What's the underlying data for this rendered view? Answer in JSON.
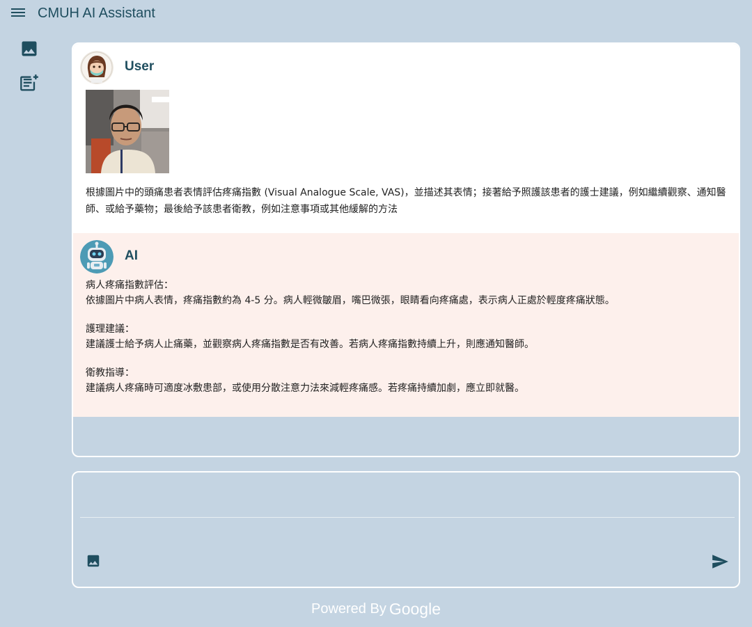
{
  "app": {
    "title": "CMUH AI Assistant"
  },
  "sidebar": {
    "icons": [
      {
        "name": "image-icon"
      },
      {
        "name": "note-add-icon"
      }
    ]
  },
  "chat": {
    "messages": [
      {
        "sender": "User",
        "avatar": "nurse-avatar",
        "image": "patient-photo",
        "text": "根據圖片中的頭痛患者表情評估疼痛指數 (Visual Analogue Scale, VAS)，並描述其表情；接著給予照護該患者的護士建議，例如繼續觀察、通知醫師、或給予藥物；最後給予該患者衛教，例如注意事項或其他緩解的方法"
      },
      {
        "sender": "AI",
        "avatar": "robot-avatar",
        "sections": [
          {
            "heading": "病人疼痛指數評估：",
            "body": "依據圖片中病人表情，疼痛指數約為 4-5 分。病人輕微皺眉，嘴巴微張，眼睛看向疼痛處，表示病人正處於輕度疼痛狀態。"
          },
          {
            "heading": "護理建議：",
            "body": "建議護士給予病人止痛藥，並觀察病人疼痛指數是否有改善。若病人疼痛指數持續上升，則應通知醫師。"
          },
          {
            "heading": "衛教指導：",
            "body": "建議病人疼痛時可適度冰敷患部，或使用分散注意力法來減輕疼痛感。若疼痛持續加劇，應立即就醫。"
          }
        ]
      }
    ]
  },
  "input": {
    "placeholder": "",
    "value": ""
  },
  "footer": {
    "powered_by": "Powered By",
    "brand": "Google"
  },
  "colors": {
    "background": "#c4d4e2",
    "accent": "#1f4e5f",
    "ai_bubble": "#fdf0ec",
    "user_bubble": "#ffffff"
  }
}
